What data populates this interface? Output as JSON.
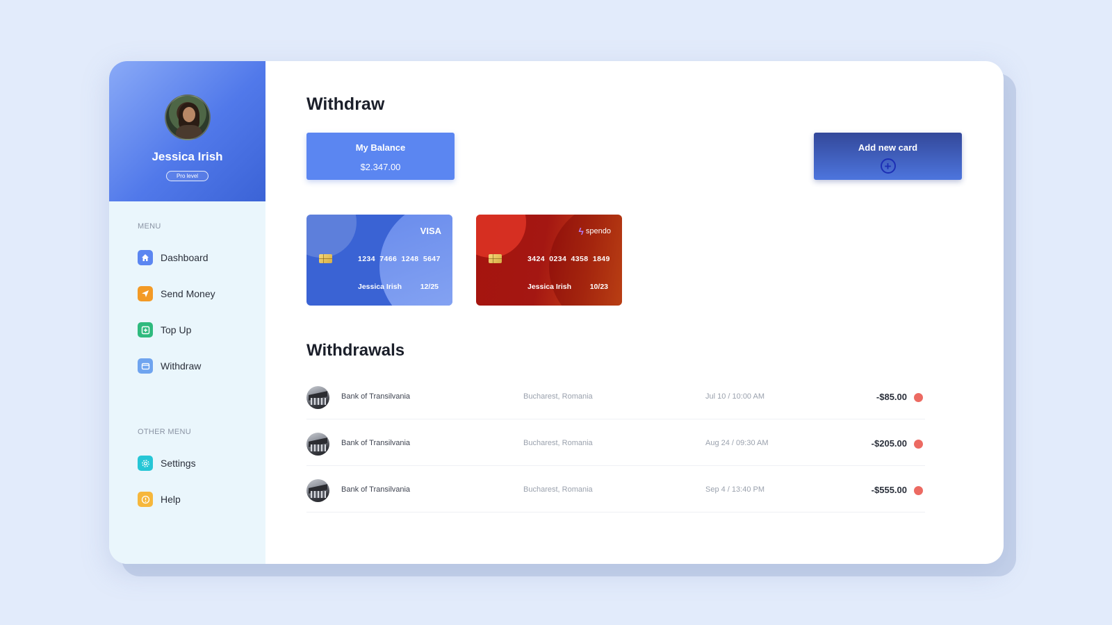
{
  "profile": {
    "name": "Jessica Irish",
    "badge": "Pro level"
  },
  "menu": {
    "heading": "MENU",
    "items": [
      {
        "label": "Dashboard",
        "icon": "home-icon",
        "color": "#5b86f1"
      },
      {
        "label": "Send Money",
        "icon": "send-icon",
        "color": "#f39a26"
      },
      {
        "label": "Top Up",
        "icon": "plus-square-icon",
        "color": "#2fba7e"
      },
      {
        "label": "Withdraw",
        "icon": "wallet-icon",
        "color": "#6fa4ef"
      }
    ]
  },
  "other_menu": {
    "heading": "OTHER MENU",
    "items": [
      {
        "label": "Settings",
        "icon": "gear-icon",
        "color": "#26c6d6"
      },
      {
        "label": "Help",
        "icon": "info-icon",
        "color": "#f6b73c"
      }
    ]
  },
  "page": {
    "title": "Withdraw"
  },
  "balance": {
    "label": "My Balance",
    "value": "$2.347.00"
  },
  "add_card": {
    "label": "Add new card",
    "icon": "plus-circle-icon"
  },
  "cards": [
    {
      "brand": "VISA",
      "number": "1234 7466 1248 5647",
      "holder": "Jessica Irish",
      "expiry": "12/25",
      "color": "#3a63d4"
    },
    {
      "brand": "spendo",
      "number": "3424 0234 4358 1849",
      "holder": "Jessica Irish",
      "expiry": "10/23",
      "color": "#a5140e"
    }
  ],
  "withdrawals": {
    "title": "Withdrawals",
    "rows": [
      {
        "bank": "Bank of Transilvania",
        "location": "Bucharest, Romania",
        "date": "Jul 10 / 10:00 AM",
        "amount": "-$85.00",
        "status_color": "#ec6a62"
      },
      {
        "bank": "Bank of Transilvania",
        "location": "Bucharest, Romania",
        "date": "Aug 24 / 09:30 AM",
        "amount": "-$205.00",
        "status_color": "#ec6a62"
      },
      {
        "bank": "Bank of Transilvania",
        "location": "Bucharest, Romania",
        "date": "Sep 4 / 13:40 PM",
        "amount": "-$555.00",
        "status_color": "#ec6a62"
      }
    ]
  }
}
